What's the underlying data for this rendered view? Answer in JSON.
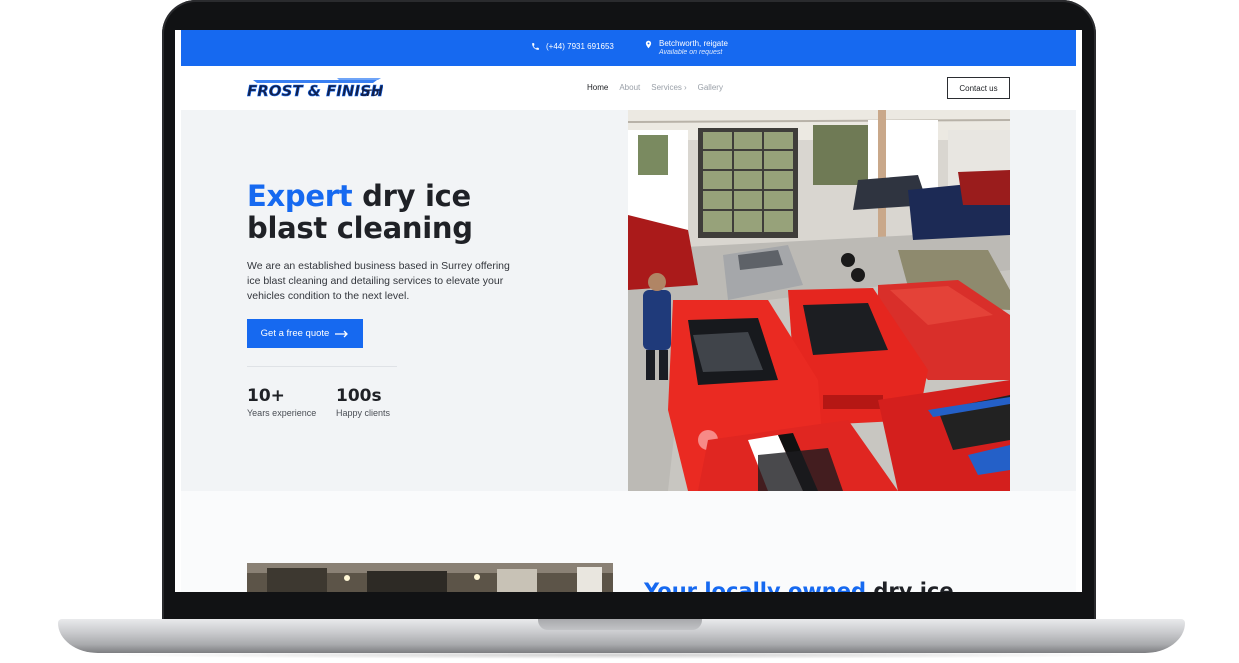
{
  "topbar": {
    "phone": "(+44) 7931 691653",
    "location": "Betchworth, reigate",
    "location_note": "Available on request"
  },
  "navbar": {
    "logo_text": "FROST & FINISH LTD",
    "links": [
      "Home",
      "About",
      "Services",
      "Gallery"
    ],
    "contact_button": "Contact us"
  },
  "hero": {
    "title_highlight": "Expert",
    "title_rest": "dry ice blast cleaning",
    "description": "We are an established business based in Surrey offering ice blast cleaning and detailing services to elevate your vehicles condition to the next level.",
    "cta": "Get a free quote",
    "stats": [
      {
        "value": "10+",
        "label": "Years experience"
      },
      {
        "value": "100s",
        "label": "Happy clients"
      }
    ],
    "image_desc": "workshop-with-red-sports-cars"
  },
  "section2": {
    "heading_highlight": "Your locally owned",
    "heading_rest": "dry ice"
  },
  "colors": {
    "accent": "#1669f0",
    "hero_bg": "#f2f4f6",
    "text_dark": "#1f2126"
  }
}
